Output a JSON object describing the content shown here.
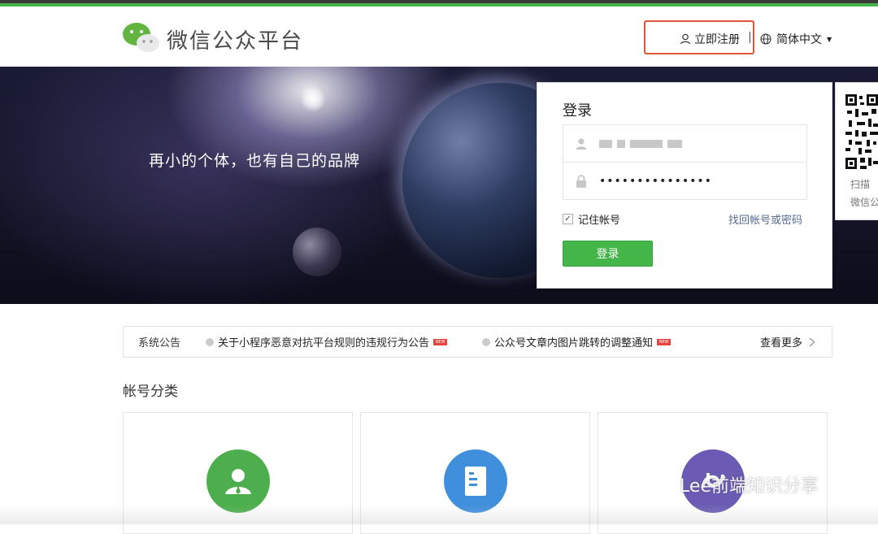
{
  "header": {
    "brand": "微信公众平台",
    "register_link": "立即注册",
    "separator": "|",
    "language": "简体中文"
  },
  "banner": {
    "slogan": "再小的个体，也有自己的品牌"
  },
  "login": {
    "title": "登录",
    "password_masked": "•••••••••••••••",
    "remember_label": "记住帐号",
    "remember_checked": true,
    "forgot_link": "找回帐号或密码",
    "submit_label": "登录"
  },
  "qr": {
    "line1": "扫描",
    "line2": "微信公"
  },
  "notices": {
    "label": "系统公告",
    "items": [
      {
        "text": "关于小程序恶意对抗平台规则的违规行为公告",
        "badge": "NEW"
      },
      {
        "text": "公众号文章内图片跳转的调整通知",
        "badge": "NEW"
      }
    ],
    "more_label": "查看更多"
  },
  "accounts": {
    "title": "帐号分类",
    "cards": [
      {
        "icon": "person-tie-icon",
        "color": "#4cae4c"
      },
      {
        "icon": "document-icon",
        "color": "#3f8fdc"
      },
      {
        "icon": "mini-program-icon",
        "color": "#6b5bb4"
      }
    ]
  },
  "watermark": {
    "text": "Lee前端知识分享"
  },
  "colors": {
    "brand_green": "#44b549",
    "link_blue": "#576b95",
    "highlight_red": "#e0533c"
  }
}
